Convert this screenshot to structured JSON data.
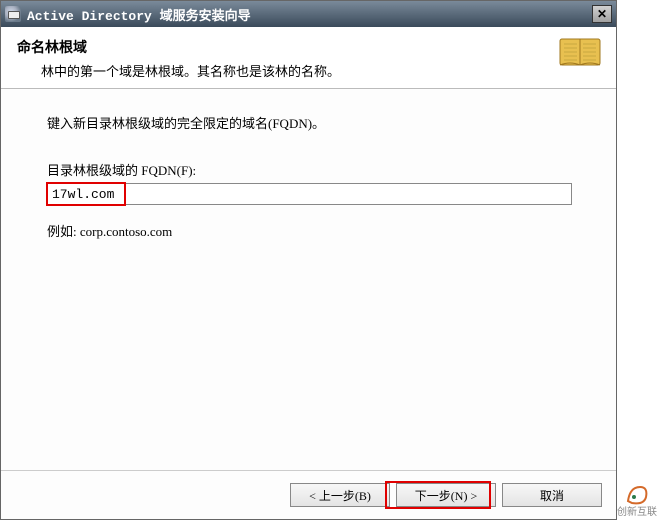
{
  "window": {
    "title": "Active Directory 域服务安装向导"
  },
  "header": {
    "heading": "命名林根域",
    "subtitle": "林中的第一个域是林根域。其名称也是该林的名称。"
  },
  "content": {
    "instruction": "键入新目录林根级域的完全限定的域名(FQDN)。",
    "label": "目录林根级域的 FQDN(F):",
    "fqdn_value": "17wl.com",
    "example": "例如: corp.contoso.com"
  },
  "footer": {
    "back": "< 上一步(B)",
    "next": "下一步(N) >",
    "cancel": "取消"
  },
  "watermark": {
    "brand": "创新互联"
  }
}
